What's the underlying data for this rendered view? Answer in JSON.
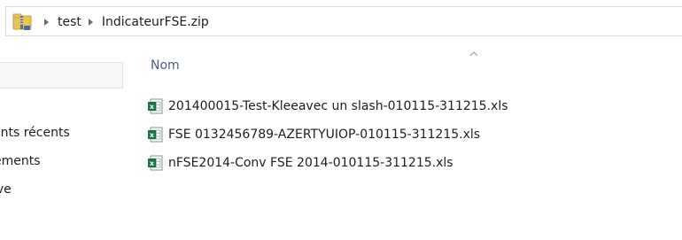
{
  "address_bar": {
    "crumbs": [
      "test",
      "IndicateurFSE.zip"
    ],
    "folder_icon": "zip-folder-icon"
  },
  "sidebar": {
    "items": [
      {
        "label": "ents récents"
      },
      {
        "label": "ements"
      },
      {
        "label": "ive"
      }
    ]
  },
  "content": {
    "column_header": "Nom",
    "sort_direction": "ascending",
    "files": [
      {
        "name": "201400015-Test-Kleeavec un slash-010115-311215.xls",
        "icon": "excel-file-icon"
      },
      {
        "name": "FSE 0132456789-AZERTYUIOP-010115-311215.xls",
        "icon": "excel-file-icon"
      },
      {
        "name": "nFSE2014-Conv FSE 2014-010115-311215.xls",
        "icon": "excel-file-icon"
      }
    ]
  },
  "colors": {
    "header_text": "#4c607a",
    "excel_green": "#1e7145",
    "folder_yellow": "#e8c15a"
  }
}
